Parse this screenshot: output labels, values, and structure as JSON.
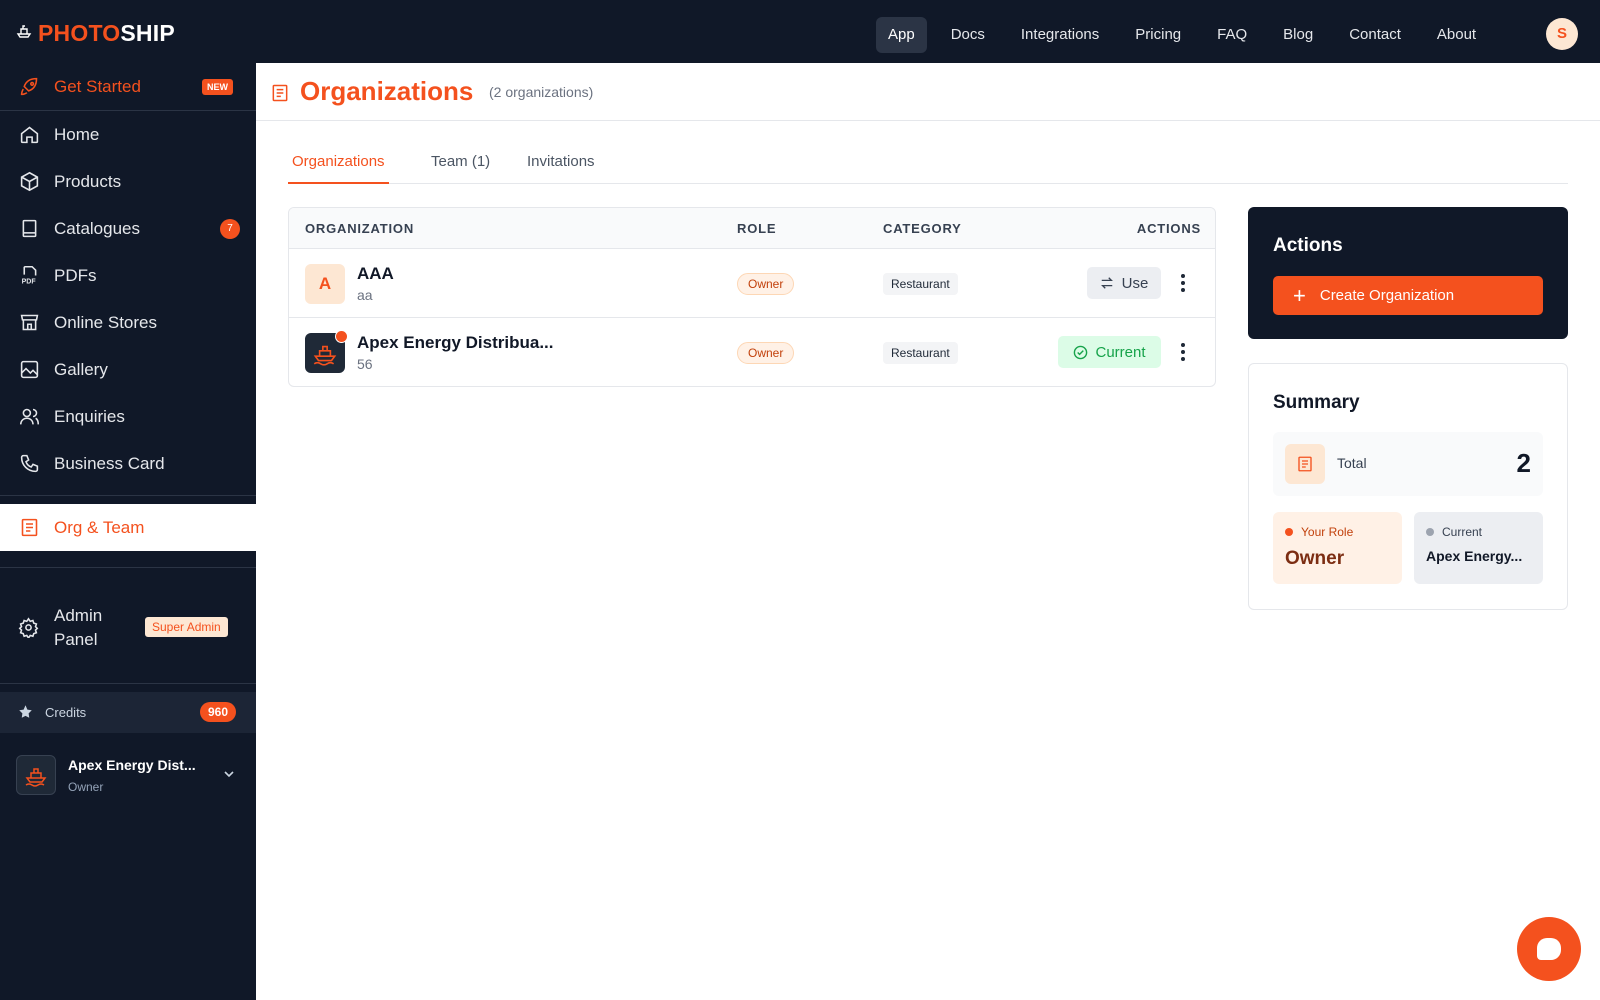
{
  "brand": {
    "name_part1": "PHOTO",
    "name_part2": "SHIP",
    "accent": "#f4511e",
    "dark": "#101828"
  },
  "topnav": {
    "items": [
      {
        "label": "App",
        "active": true
      },
      {
        "label": "Docs"
      },
      {
        "label": "Integrations"
      },
      {
        "label": "Pricing"
      },
      {
        "label": "FAQ"
      },
      {
        "label": "Blog"
      },
      {
        "label": "Contact"
      },
      {
        "label": "About"
      }
    ],
    "user_initial": "S"
  },
  "sidebar": {
    "items": [
      {
        "label": "Get Started",
        "icon": "rocket-icon",
        "badge": "NEW"
      },
      {
        "label": "Home",
        "icon": "home-icon"
      },
      {
        "label": "Products",
        "icon": "box-icon"
      },
      {
        "label": "Catalogues",
        "icon": "book-icon",
        "badge": "7"
      },
      {
        "label": "PDFs",
        "icon": "pdf-icon"
      },
      {
        "label": "Online Stores",
        "icon": "store-icon"
      },
      {
        "label": "Gallery",
        "icon": "image-icon"
      },
      {
        "label": "Enquiries",
        "icon": "users-icon"
      },
      {
        "label": "Business Card",
        "icon": "phone-icon"
      },
      {
        "label": "Org & Team",
        "icon": "org-icon",
        "selected": true
      }
    ],
    "admin": {
      "label": "Admin Panel",
      "icon": "gear-icon",
      "badge": "Super Admin"
    },
    "credits": {
      "label": "Credits",
      "value": "960",
      "icon": "star-icon"
    },
    "org_switcher": {
      "name": "Apex Energy Dist...",
      "role": "Owner"
    }
  },
  "page": {
    "title": "Organizations",
    "count_text": "(2 organizations)"
  },
  "tabs": [
    {
      "label": "Organizations",
      "active": true
    },
    {
      "label": "Team (1)"
    },
    {
      "label": "Invitations"
    }
  ],
  "table": {
    "headers": {
      "organization": "ORGANIZATION",
      "role": "ROLE",
      "category": "CATEGORY",
      "actions": "ACTIONS"
    },
    "rows": [
      {
        "initial": "A",
        "name": "AAA",
        "sub": "aa",
        "role": "Owner",
        "category": "Restaurant",
        "action": "Use"
      },
      {
        "name": "Apex Energy Distribua...",
        "sub": "56",
        "role": "Owner",
        "category": "Restaurant",
        "action": "Current"
      }
    ]
  },
  "actions_panel": {
    "title": "Actions",
    "create_label": "Create Organization"
  },
  "summary": {
    "title": "Summary",
    "total_label": "Total",
    "total_value": "2",
    "role_label": "Your Role",
    "role_value": "Owner",
    "current_label": "Current",
    "current_value": "Apex Energy..."
  }
}
